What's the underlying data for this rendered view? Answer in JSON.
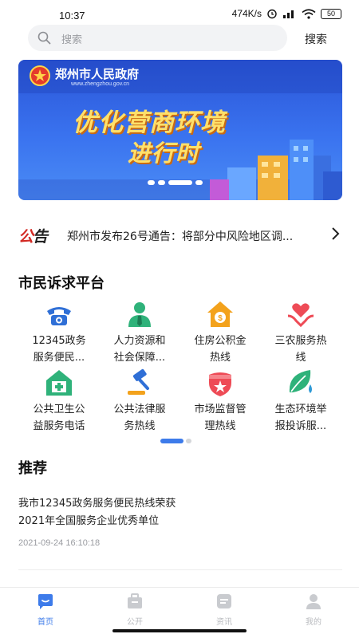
{
  "status_bar": {
    "time": "10:37",
    "net_speed": "474K/s",
    "battery": "50"
  },
  "search": {
    "placeholder": "搜索",
    "button_label": "搜索"
  },
  "banner": {
    "gov_name": "郑州市人民政府",
    "gov_url": "www.zhengzhou.gov.cn",
    "headline_line1": "优化营商环境",
    "headline_line2": "进行时",
    "slides_count": 4,
    "active_slide": 2
  },
  "notice": {
    "tag_red": "公",
    "tag_black": "告",
    "text": "郑州市发布26号通告：将部分中风险地区调..."
  },
  "platform": {
    "title": "市民诉求平台",
    "services": [
      {
        "label_line1": "12345政务",
        "label_line2": "服务便民...",
        "icon": "telephone-icon"
      },
      {
        "label_line1": "人力资源和",
        "label_line2": "社会保障...",
        "icon": "staff-person-icon"
      },
      {
        "label_line1": "住房公积金",
        "label_line2": "热线",
        "icon": "house-coin-icon"
      },
      {
        "label_line1": "三农服务热",
        "label_line2": "线",
        "icon": "heart-hands-icon"
      },
      {
        "label_line1": "公共卫生公",
        "label_line2": "益服务电话",
        "icon": "medical-house-icon"
      },
      {
        "label_line1": "公共法律服",
        "label_line2": "务热线",
        "icon": "gavel-icon"
      },
      {
        "label_line1": "市场监督管",
        "label_line2": "理热线",
        "icon": "shield-star-icon"
      },
      {
        "label_line1": "生态环境举",
        "label_line2": "报投诉服...",
        "icon": "leaf-drop-icon"
      }
    ],
    "pages_count": 2,
    "active_page": 1
  },
  "recommend": {
    "title": "推荐",
    "items": [
      {
        "title_line1": "我市12345政务服务便民热线荣获",
        "title_line2": "2021年全国服务企业优秀单位",
        "time": "2021-09-24 16:10:18"
      }
    ]
  },
  "tabbar": {
    "tabs": [
      {
        "label": "首页",
        "icon": "home-chat-icon",
        "active": true
      },
      {
        "label": "公开",
        "icon": "briefcase-icon",
        "active": false
      },
      {
        "label": "资讯",
        "icon": "news-icon",
        "active": false
      },
      {
        "label": "我的",
        "icon": "user-icon",
        "active": false
      }
    ]
  },
  "colors": {
    "accent": "#3d7bea",
    "notice_red": "#d32a24",
    "banner_yellow": "#ffe06a",
    "icon_blue": "#2f6fd6",
    "icon_green": "#2fb27a",
    "icon_orange": "#f3a21c",
    "icon_red": "#ee4b56"
  }
}
